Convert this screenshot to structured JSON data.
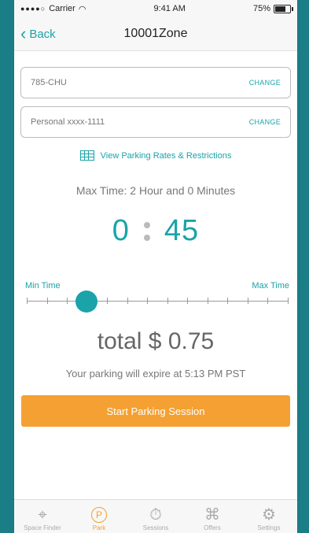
{
  "status": {
    "carrier": "Carrier",
    "time": "9:41 AM",
    "battery_text": "75%",
    "battery_level": 0.75
  },
  "nav": {
    "back_label": "Back",
    "title": "10001Zone"
  },
  "vehicle": {
    "value": "785-CHU",
    "change_label": "CHANGE"
  },
  "payment": {
    "value": "Personal xxxx-1111",
    "change_label": "CHANGE"
  },
  "rates_link": "View Parking Rates & Restrictions",
  "max_time": "Max Time: 2 Hour and 0 Minutes",
  "timer": {
    "hours": "0",
    "minutes": "45"
  },
  "slider": {
    "min_label": "Min Time",
    "max_label": "Max Time",
    "ticks": 14,
    "value_fraction": 0.23
  },
  "total": "total $ 0.75",
  "expire_text": "Your parking will expire at 5:13 PM PST",
  "start_button": "Start Parking Session",
  "tabs": [
    {
      "label": "Space Finder",
      "icon": "location-pin-icon"
    },
    {
      "label": "Park",
      "icon": "park-icon"
    },
    {
      "label": "Sessions",
      "icon": "stopwatch-icon"
    },
    {
      "label": "Offers",
      "icon": "tag-icon"
    },
    {
      "label": "Settings",
      "icon": "gear-icon"
    }
  ],
  "colors": {
    "accent": "#1aa3a8",
    "orange": "#f5a033",
    "background": "#1b7d86"
  }
}
